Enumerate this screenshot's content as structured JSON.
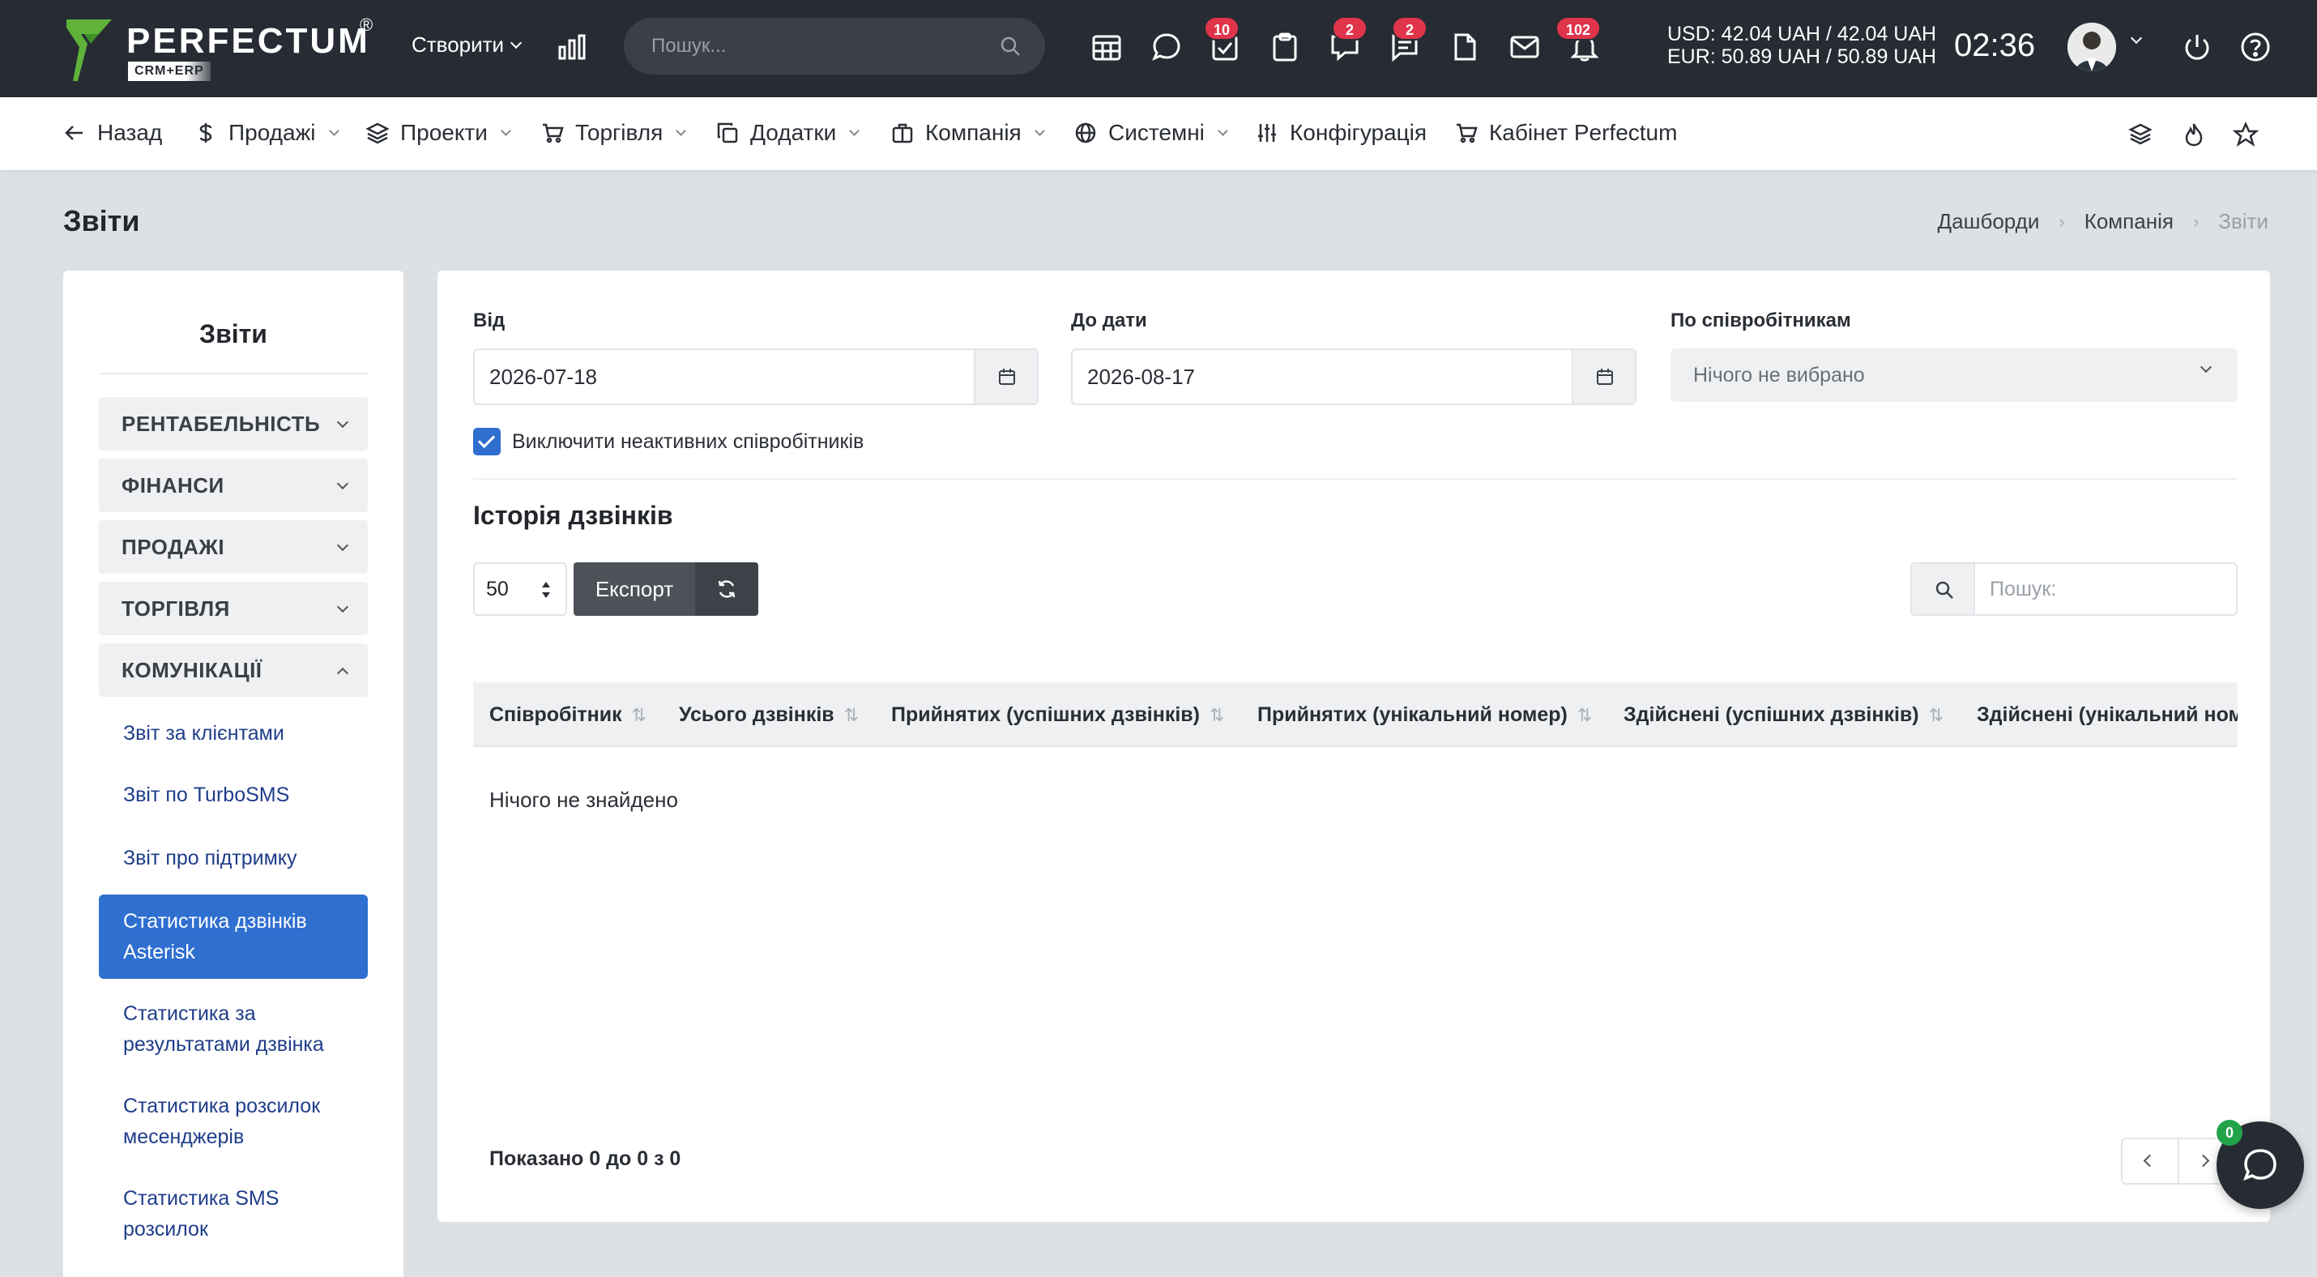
{
  "brand": {
    "name": "PERFECTUM",
    "registered": "®",
    "sub": "CRM+ERP",
    "accent": "#5fb33a"
  },
  "topbar": {
    "create_label": "Створити",
    "search_placeholder": "Пошук...",
    "badges": {
      "tasks": "10",
      "discussions": "2",
      "chat": "2",
      "notifications": "102"
    },
    "rates": {
      "usd": "USD: 42.04 UAH / 42.04 UAH",
      "eur": "EUR: 50.89 UAH / 50.89 UAH"
    },
    "clock": "02:36"
  },
  "nav": {
    "back": "Назад",
    "sales": "Продажі",
    "projects": "Проекти",
    "trade": "Торгівля",
    "addons": "Додатки",
    "company": "Компанія",
    "system": "Системні",
    "config": "Конфігурація",
    "cabinet": "Кабінет Perfectum"
  },
  "page": {
    "title": "Звіти",
    "breadcrumbs": [
      "Дашборди",
      "Компанія",
      "Звіти"
    ]
  },
  "sidebar": {
    "title": "Звіти",
    "groups": [
      "РЕНТАБЕЛЬНІСТЬ",
      "ФІНАНСИ",
      "ПРОДАЖІ",
      "ТОРГІВЛЯ",
      "КОМУНІКАЦІЇ"
    ],
    "links": [
      "Звіт за клієнтами",
      "Звіт по TurboSMS",
      "Звіт про підтримку",
      "Статистика дзвінків Asterisk",
      "Статистика за результатами дзвінка",
      "Статистика розсилок месенджерів",
      "Статистика SMS розсилок"
    ]
  },
  "filters": {
    "from_label": "Від",
    "from_value": "2026-07-18",
    "to_label": "До дати",
    "to_value": "2026-08-17",
    "staff_label": "По співробітникам",
    "staff_value": "Нічого не вибрано",
    "exclude_inactive_label": "Виключити неактивних співробітників"
  },
  "report": {
    "title": "Історія дзвінків",
    "page_length": "50",
    "export_label": "Експорт",
    "search_placeholder": "Пошук:",
    "columns": [
      "Співробітник",
      "Усього дзвінків",
      "Прийнятих (успішних дзвінків)",
      "Прийнятих (унікальний номер)",
      "Здійснені (успішних дзвінків)",
      "Здійснені (унікальний номер)"
    ],
    "empty": "Нічого не знайдено",
    "info": "Показано 0 до 0 з 0"
  },
  "chat": {
    "count": "0"
  }
}
